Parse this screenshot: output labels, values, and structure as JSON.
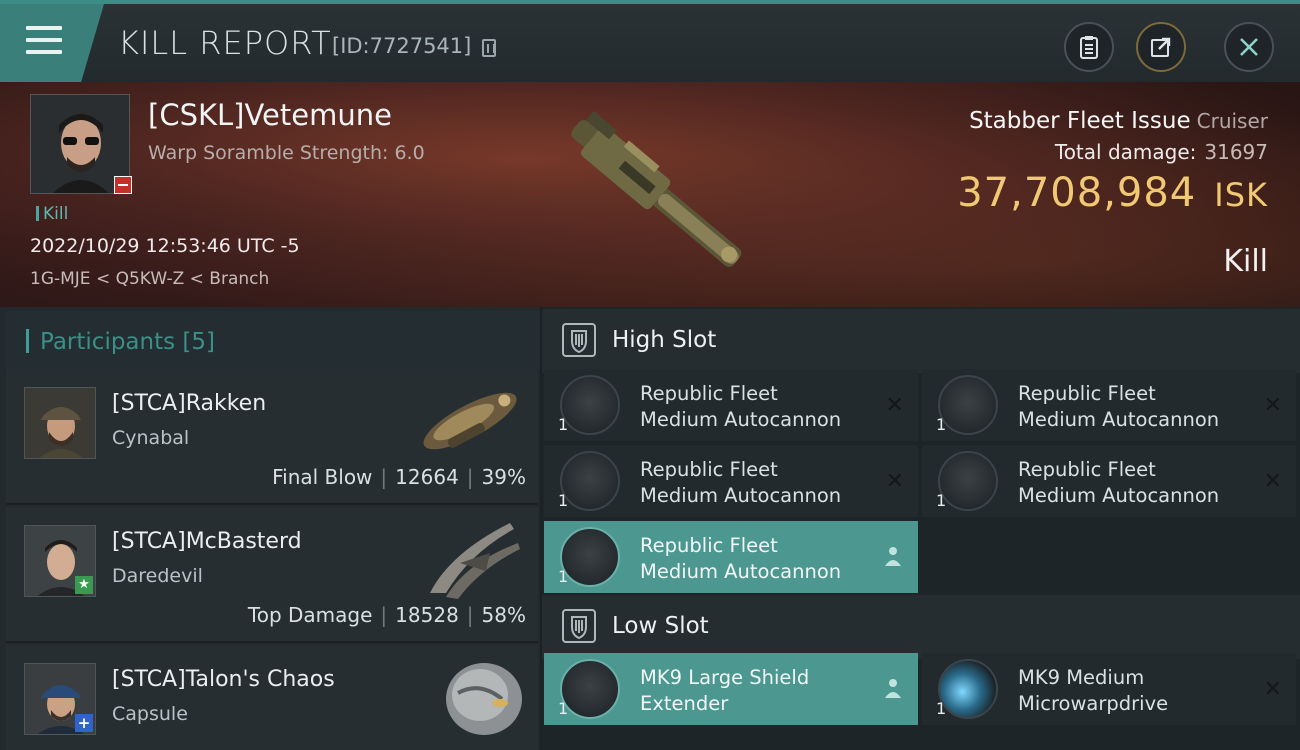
{
  "header": {
    "title": "KILL REPORT",
    "report_id": "[ID:7727541]"
  },
  "victim": {
    "name": "[CSKL]Vetemune",
    "warp_scramble": "Warp Soramble Strength: 6.0",
    "tag": "Kill",
    "datetime": "2022/10/29 12:53:46 UTC -5",
    "location": "1G-MJE < Q5KW-Z < Branch",
    "ship": "Stabber Fleet Issue",
    "ship_class": "Cruiser",
    "total_damage_label": "Total damage:",
    "total_damage": "31697",
    "isk_value": "37,708,984",
    "isk_unit": "ISK",
    "result": "Kill"
  },
  "participants": {
    "label": "Participants",
    "count": "[5]",
    "rows": [
      {
        "name": "[STCA]Rakken",
        "ship": "Cynabal",
        "role": "Final Blow",
        "damage": "12664",
        "percent": "39%"
      },
      {
        "name": "[STCA]McBasterd",
        "ship": "Daredevil",
        "role": "Top Damage",
        "damage": "18528",
        "percent": "58%"
      },
      {
        "name": "[STCA]Talon's Chaos",
        "ship": "Capsule",
        "role": "",
        "damage": "",
        "percent": ""
      }
    ]
  },
  "fitting": {
    "high_slot_label": "High Slot",
    "low_slot_label": "Low Slot",
    "high": [
      {
        "line1": "Republic Fleet",
        "line2": "Medium Autocannon",
        "qty": "1"
      },
      {
        "line1": "Republic Fleet",
        "line2": "Medium Autocannon",
        "qty": "1"
      },
      {
        "line1": "Republic Fleet",
        "line2": "Medium Autocannon",
        "qty": "1"
      },
      {
        "line1": "Republic Fleet",
        "line2": "Medium Autocannon",
        "qty": "1"
      },
      {
        "line1": "Republic Fleet",
        "line2": "Medium Autocannon",
        "qty": "1"
      }
    ],
    "low": [
      {
        "line1": "MK9 Large Shield",
        "line2": "Extender",
        "qty": "1"
      },
      {
        "line1": "MK9 Medium",
        "line2": "Microwarpdrive",
        "qty": "1"
      }
    ]
  },
  "colors": {
    "accent": "#3f9e96",
    "isk": "#f1c873",
    "highlight_row": "#4c9891",
    "danger_badge": "#c4302a"
  },
  "icons": [
    "menu-icon",
    "copy-icon",
    "clipboard-icon",
    "share-icon",
    "close-icon",
    "shield-slot-icon",
    "remove-icon",
    "pilot-icon"
  ]
}
